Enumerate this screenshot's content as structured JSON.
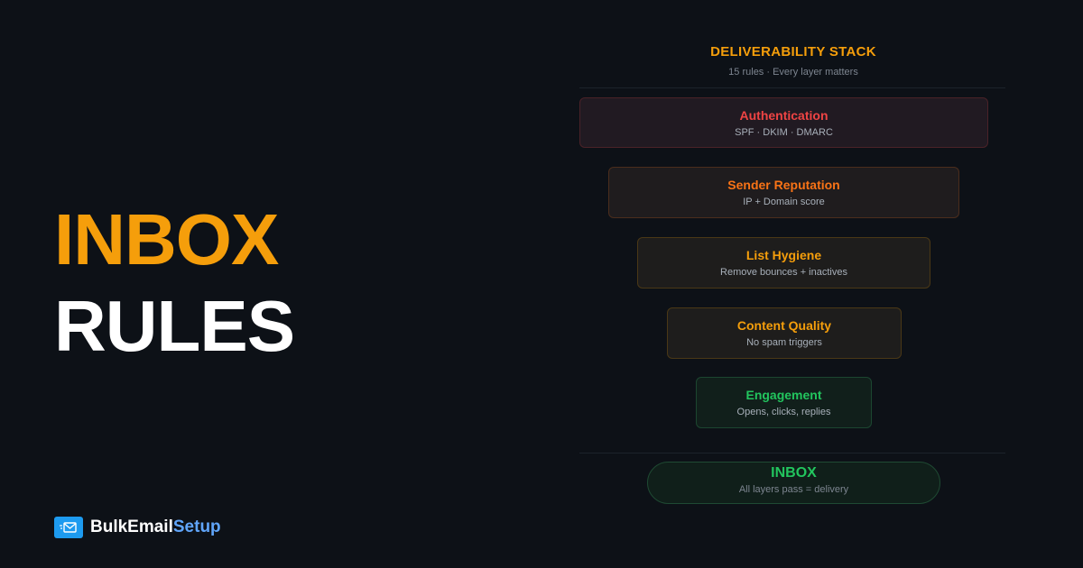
{
  "hero": {
    "line1": "INBOX",
    "line2": "RULES"
  },
  "brand": {
    "name_primary": "BulkEmail",
    "name_accent": "Setup",
    "icon": "envelope-icon"
  },
  "stack": {
    "title": "DELIVERABILITY STACK",
    "subtitle": "15 rules · Every layer matters",
    "layers": [
      {
        "name": "Authentication",
        "desc": "SPF · DKIM · DMARC",
        "color": "#ef4444"
      },
      {
        "name": "Sender Reputation",
        "desc": "IP + Domain score",
        "color": "#f97316"
      },
      {
        "name": "List Hygiene",
        "desc": "Remove bounces + inactives",
        "color": "#f59e0b"
      },
      {
        "name": "Content Quality",
        "desc": "No spam triggers",
        "color": "#f59e0b"
      },
      {
        "name": "Engagement",
        "desc": "Opens, clicks, replies",
        "color": "#22c55e"
      }
    ],
    "result": {
      "name": "INBOX",
      "desc": "All layers pass = delivery",
      "color": "#22c55e"
    }
  },
  "colors": {
    "background": "#0d1117",
    "accent_orange": "#f59e0b",
    "accent_blue": "#60a5fa",
    "text_white": "#ffffff"
  }
}
